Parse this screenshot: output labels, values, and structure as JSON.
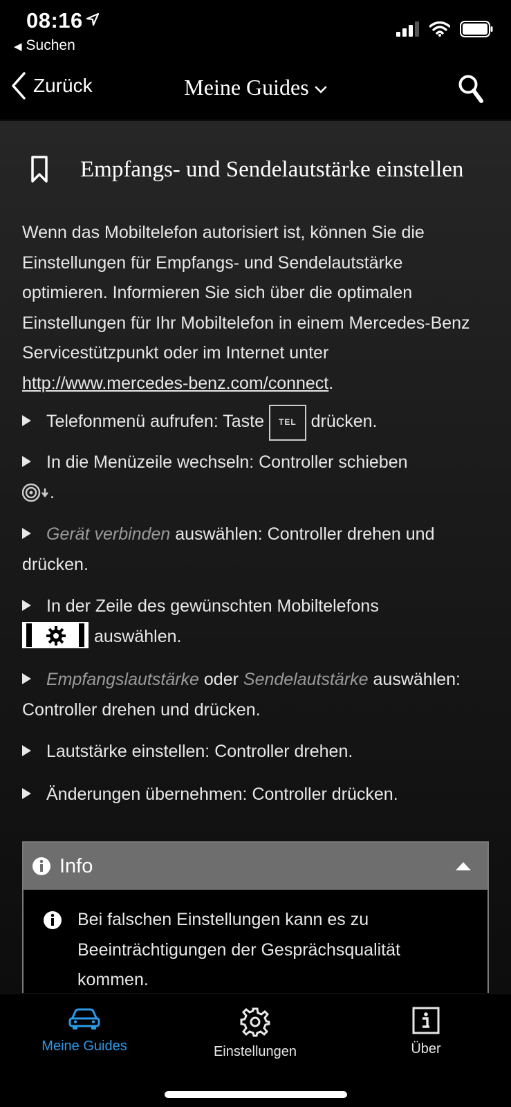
{
  "status": {
    "time": "08:16",
    "back_app": "Suchen"
  },
  "nav": {
    "back_label": "Zurück",
    "title": "Meine Guides"
  },
  "article": {
    "title": "Empfangs- und Sendelautstärke einstellen",
    "intro_text": "Wenn das Mobiltelefon autorisiert ist, können Sie die Einstellungen für Empfangs- und Sendelautstärke optimieren. Informieren Sie sich über die optimalen Einstellungen für Ihr Mobiltelefon in einem Mercedes-Benz Servicestützpunkt oder im Internet unter ",
    "link": "http://www.mercedes-benz.com/connect",
    "intro_end": "."
  },
  "steps": {
    "s1_a": "Telefonmenü aufrufen: Taste ",
    "s1_key": "TEL",
    "s1_b": " drücken.",
    "s2_a": "In die Menüzeile wechseln: Controller schieben",
    "s2_b": ".",
    "s3_em": "Gerät verbinden",
    "s3_b": " auswählen: Controller drehen und drücken.",
    "s4_a": "In der Zeile des gewünschten Mobiltelefons",
    "s4_b": "auswählen.",
    "s5_em1": "Empfangslautstärke",
    "s5_mid": " oder ",
    "s5_em2": "Sendelautstärke",
    "s5_b": " auswählen: Controller drehen und drücken.",
    "s6": "Lautstärke einstellen: Controller drehen.",
    "s7": "Änderungen übernehmen: Controller drücken."
  },
  "info": {
    "title": "Info",
    "text": "Bei falschen Einstellungen kann es zu Beeinträchtigungen der Gesprächsqualität kommen."
  },
  "tabs": {
    "guides": "Meine Guides",
    "settings": "Einstellungen",
    "about": "Über"
  },
  "colors": {
    "accent": "#2b9ae8",
    "info_header": "#6e6e6e"
  }
}
